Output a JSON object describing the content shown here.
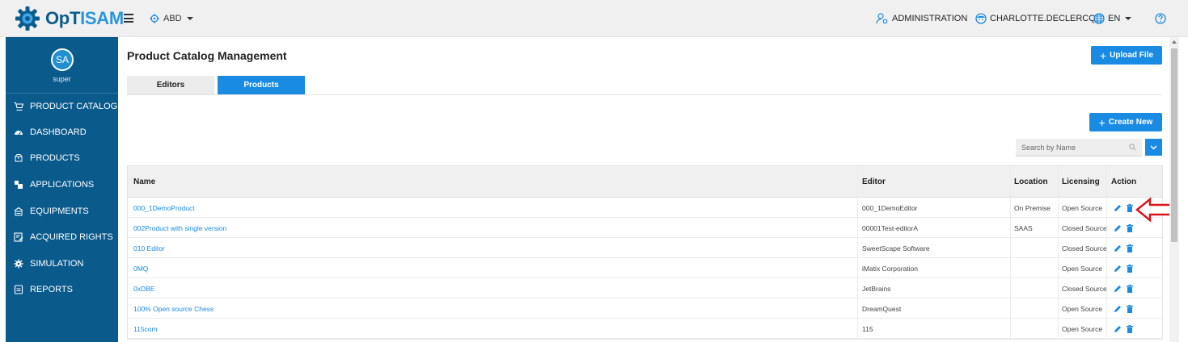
{
  "app": {
    "name_prefix": "OpT",
    "name_suffix": "ISAM",
    "tenant": "ABD",
    "language": "EN"
  },
  "header": {
    "administration": "ADMINISTRATION",
    "user": "CHARLOTTE.DECLERCQ"
  },
  "sidebar": {
    "avatar_initials": "SA",
    "username": "super",
    "items": [
      {
        "label": "PRODUCT CATALOG",
        "icon": "cart-icon"
      },
      {
        "label": "DASHBOARD",
        "icon": "dashboard-icon"
      },
      {
        "label": "PRODUCTS",
        "icon": "box-icon"
      },
      {
        "label": "APPLICATIONS",
        "icon": "cubes-icon"
      },
      {
        "label": "EQUIPMENTS",
        "icon": "server-icon"
      },
      {
        "label": "ACQUIRED RIGHTS",
        "icon": "rights-icon"
      },
      {
        "label": "SIMULATION",
        "icon": "gear-icon"
      },
      {
        "label": "REPORTS",
        "icon": "report-icon"
      }
    ]
  },
  "main": {
    "title": "Product Catalog Management",
    "upload_label": "Upload File",
    "tabs": [
      {
        "label": "Editors"
      },
      {
        "label": "Products",
        "active": true
      }
    ],
    "create_label": "Create New",
    "search_placeholder": "Search by Name"
  },
  "table": {
    "headers": {
      "name": "Name",
      "editor": "Editor",
      "location": "Location",
      "licensing": "Licensing",
      "action": "Action"
    },
    "rows": [
      {
        "name": "000_1DemoProduct",
        "editor": "000_1DemoEditor",
        "location": "On Premise",
        "licensing": "Open Source"
      },
      {
        "name": "002Product with single version",
        "editor": "00001Test-editorA",
        "location": "SAAS",
        "licensing": "Closed Source"
      },
      {
        "name": "010 Editor",
        "editor": "SweetScape Software",
        "location": "",
        "licensing": "Closed Source"
      },
      {
        "name": "0MQ",
        "editor": "iMatix Corporation",
        "location": "",
        "licensing": "Open Source"
      },
      {
        "name": "0xDBE",
        "editor": "JetBrains",
        "location": "",
        "licensing": "Closed Source"
      },
      {
        "name": "100% Open source Chess",
        "editor": "DreamQuest",
        "location": "",
        "licensing": "Open Source"
      },
      {
        "name": "115com",
        "editor": "115",
        "location": "",
        "licensing": "Open Source"
      }
    ]
  },
  "colors": {
    "primary": "#1a8be3",
    "sidebar": "#0b5a8c",
    "annotation": "#d9141b"
  }
}
